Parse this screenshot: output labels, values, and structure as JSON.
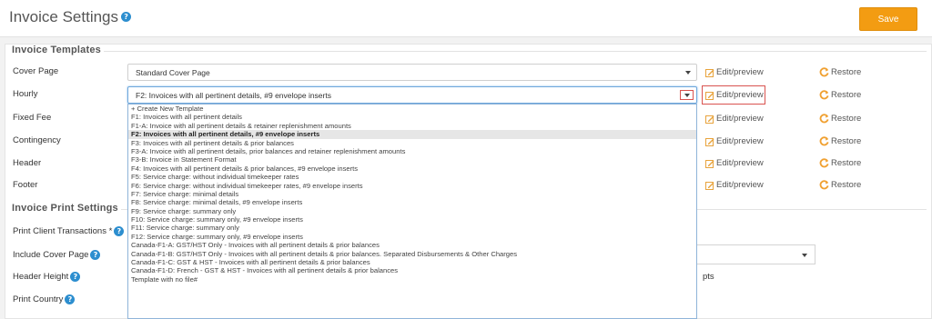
{
  "header": {
    "title": "Invoice Settings",
    "save_label": "Save"
  },
  "templates": {
    "legend": "Invoice Templates",
    "rows": [
      {
        "label": "Cover Page",
        "select_value": "Standard Cover Page",
        "edit_label": "Edit/preview",
        "restore_label": "Restore"
      },
      {
        "label": "Hourly",
        "select_value": "F2: Invoices with all pertinent details, #9 envelope inserts",
        "edit_label": "Edit/preview",
        "restore_label": "Restore"
      },
      {
        "label": "Fixed Fee",
        "edit_label": "Edit/preview",
        "restore_label": "Restore"
      },
      {
        "label": "Contingency",
        "edit_label": "Edit/preview",
        "restore_label": "Restore"
      },
      {
        "label": "Header",
        "edit_label": "Edit/preview",
        "restore_label": "Restore"
      },
      {
        "label": "Footer",
        "edit_label": "Edit/preview",
        "restore_label": "Restore"
      }
    ]
  },
  "dropdown": {
    "options": [
      "+ Create New Template",
      "F1: Invoices with all pertinent details",
      "F1-A: Invoice with all pertinent details & retainer replenishment amounts",
      "F2: Invoices with all pertinent details, #9 envelope inserts",
      "F3: Invoices with all pertinent details & prior balances",
      "F3-A: Invoice with all pertinent details, prior balances and retainer replenishment amounts",
      "F3-B: Invoice in Statement Format",
      "F4: Invoices with all pertinent details & prior balances, #9 envelope inserts",
      "F5: Service charge: without individual timekeeper rates",
      "F6: Service charge: without individual timekeeper rates, #9 envelope inserts",
      "F7: Service charge: minimal details",
      "F8: Service charge: minimal details, #9 envelope inserts",
      "F9: Service charge: summary only",
      "F10: Service charge: summary only, #9 envelope inserts",
      "F11: Service charge: summary only",
      "F12: Service charge: summary only, #9 envelope inserts",
      "Canada-F1-A: GST/HST Only - Invoices with all pertinent details & prior balances",
      "Canada-F1-B: GST/HST Only - Invoices with all pertinent details & prior balances. Separated Disbursements & Other Charges",
      "Canada-F1-C: GST & HST - Invoices with all pertinent details & prior balances",
      "Canada-F1-D: French - GST & HST - Invoices with all pertinent details & prior balances",
      "Template with no file#"
    ],
    "selected_index": 3
  },
  "print_settings": {
    "legend": "Invoice Print Settings",
    "rows": [
      {
        "label": "Print Client Transactions *"
      },
      {
        "label": "Include Cover Page"
      },
      {
        "label": "Header Height",
        "unit": "pts"
      },
      {
        "label": "Print Country"
      }
    ]
  },
  "colors": {
    "accent": "#f39c12",
    "help": "#2c8ecf",
    "highlight": "#d9534f",
    "edit_icon": "#e8a33c",
    "restore_icon": "#f0a030"
  }
}
